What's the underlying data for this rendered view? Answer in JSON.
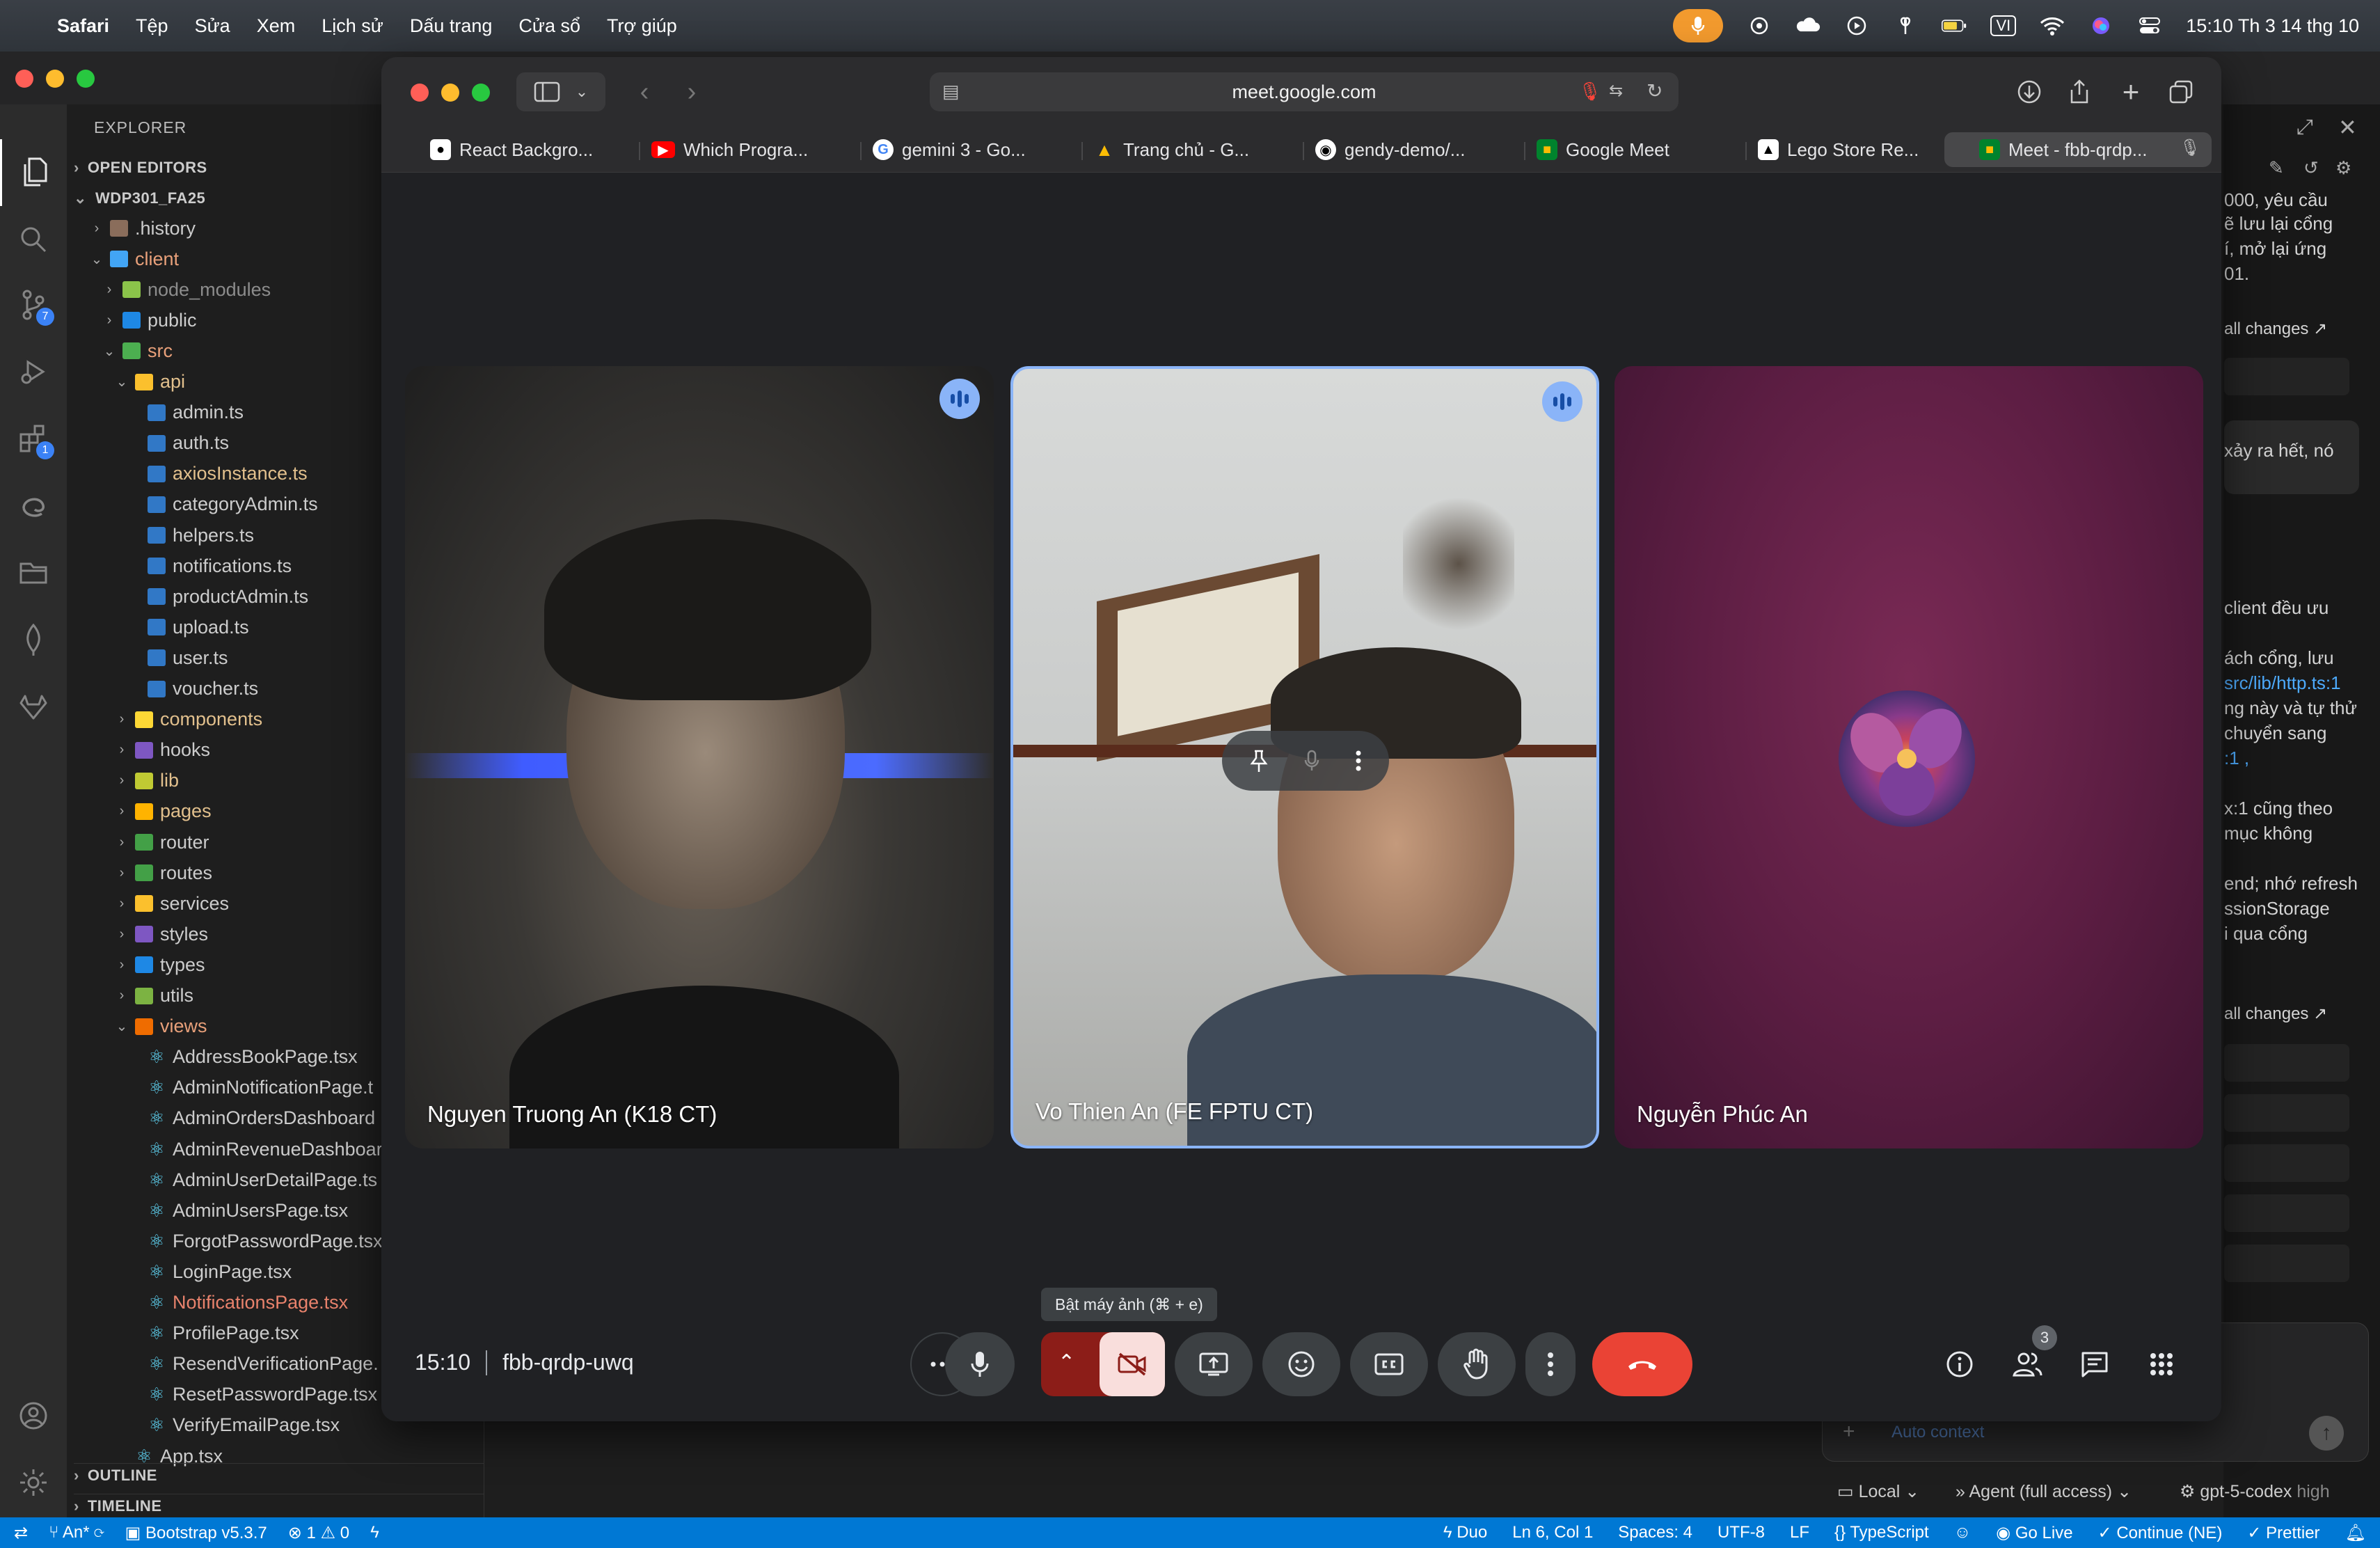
{
  "menubar": {
    "app": "Safari",
    "items": [
      "Tệp",
      "Sửa",
      "Xem",
      "Lịch sử",
      "Dấu trang",
      "Cửa sổ",
      "Trợ giúp"
    ],
    "input_lang": "VI",
    "clock": "15:10 Th 3 14 thg 10"
  },
  "vscode": {
    "explorer_title": "EXPLORER",
    "open_editors": "OPEN EDITORS",
    "workspace": "WDP301_FA25",
    "tree": [
      {
        "label": ".history",
        "depth": 1,
        "kind": "folder",
        "open": false,
        "color": "#cccccc",
        "icon": "history-folder"
      },
      {
        "label": "client",
        "depth": 1,
        "kind": "folder",
        "open": true,
        "color": "#e8a07a",
        "icon": "client-folder"
      },
      {
        "label": "node_modules",
        "depth": 2,
        "kind": "folder",
        "open": false,
        "color": "#8c8c8c",
        "icon": "node-folder"
      },
      {
        "label": "public",
        "depth": 2,
        "kind": "folder",
        "open": false,
        "color": "#cccccc",
        "icon": "public-folder"
      },
      {
        "label": "src",
        "depth": 2,
        "kind": "folder",
        "open": true,
        "color": "#e8a07a",
        "icon": "src-folder"
      },
      {
        "label": "api",
        "depth": 3,
        "kind": "folder",
        "open": true,
        "color": "#e2c08d",
        "icon": "api-folder"
      },
      {
        "label": "admin.ts",
        "depth": 4,
        "kind": "ts",
        "color": "#cccccc"
      },
      {
        "label": "auth.ts",
        "depth": 4,
        "kind": "ts",
        "color": "#cccccc"
      },
      {
        "label": "axiosInstance.ts",
        "depth": 4,
        "kind": "ts",
        "color": "#e2c08d"
      },
      {
        "label": "categoryAdmin.ts",
        "depth": 4,
        "kind": "ts",
        "color": "#cccccc"
      },
      {
        "label": "helpers.ts",
        "depth": 4,
        "kind": "ts",
        "color": "#cccccc"
      },
      {
        "label": "notifications.ts",
        "depth": 4,
        "kind": "ts",
        "color": "#cccccc"
      },
      {
        "label": "productAdmin.ts",
        "depth": 4,
        "kind": "ts",
        "color": "#cccccc"
      },
      {
        "label": "upload.ts",
        "depth": 4,
        "kind": "ts",
        "color": "#cccccc"
      },
      {
        "label": "user.ts",
        "depth": 4,
        "kind": "ts",
        "color": "#cccccc"
      },
      {
        "label": "voucher.ts",
        "depth": 4,
        "kind": "ts",
        "color": "#cccccc"
      },
      {
        "label": "components",
        "depth": 3,
        "kind": "folder",
        "open": false,
        "color": "#e2c08d",
        "icon": "components-folder"
      },
      {
        "label": "hooks",
        "depth": 3,
        "kind": "folder",
        "open": false,
        "color": "#cccccc",
        "icon": "hooks-folder"
      },
      {
        "label": "lib",
        "depth": 3,
        "kind": "folder",
        "open": false,
        "color": "#e2c08d",
        "icon": "lib-folder"
      },
      {
        "label": "pages",
        "depth": 3,
        "kind": "folder",
        "open": false,
        "color": "#e2c08d",
        "icon": "pages-folder"
      },
      {
        "label": "router",
        "depth": 3,
        "kind": "folder",
        "open": false,
        "color": "#cccccc",
        "icon": "router-folder"
      },
      {
        "label": "routes",
        "depth": 3,
        "kind": "folder",
        "open": false,
        "color": "#cccccc",
        "icon": "routes-folder"
      },
      {
        "label": "services",
        "depth": 3,
        "kind": "folder",
        "open": false,
        "color": "#cccccc",
        "icon": "services-folder"
      },
      {
        "label": "styles",
        "depth": 3,
        "kind": "folder",
        "open": false,
        "color": "#cccccc",
        "icon": "styles-folder"
      },
      {
        "label": "types",
        "depth": 3,
        "kind": "folder",
        "open": false,
        "color": "#cccccc",
        "icon": "types-folder"
      },
      {
        "label": "utils",
        "depth": 3,
        "kind": "folder",
        "open": false,
        "color": "#cccccc",
        "icon": "utils-folder"
      },
      {
        "label": "views",
        "depth": 3,
        "kind": "folder",
        "open": true,
        "color": "#e8a07a",
        "icon": "views-folder"
      },
      {
        "label": "AddressBookPage.tsx",
        "depth": 4,
        "kind": "tsx",
        "color": "#cccccc"
      },
      {
        "label": "AdminNotificationPage.t",
        "depth": 4,
        "kind": "tsx",
        "color": "#cccccc"
      },
      {
        "label": "AdminOrdersDashboard",
        "depth": 4,
        "kind": "tsx",
        "color": "#cccccc"
      },
      {
        "label": "AdminRevenueDashboar",
        "depth": 4,
        "kind": "tsx",
        "color": "#cccccc"
      },
      {
        "label": "AdminUserDetailPage.ts",
        "depth": 4,
        "kind": "tsx",
        "color": "#cccccc"
      },
      {
        "label": "AdminUsersPage.tsx",
        "depth": 4,
        "kind": "tsx",
        "color": "#cccccc"
      },
      {
        "label": "ForgotPasswordPage.tsx",
        "depth": 4,
        "kind": "tsx",
        "color": "#cccccc"
      },
      {
        "label": "LoginPage.tsx",
        "depth": 4,
        "kind": "tsx",
        "color": "#cccccc"
      },
      {
        "label": "NotificationsPage.tsx",
        "depth": 4,
        "kind": "tsx",
        "color": "#e8826c"
      },
      {
        "label": "ProfilePage.tsx",
        "depth": 4,
        "kind": "tsx",
        "color": "#cccccc"
      },
      {
        "label": "ResendVerificationPage.",
        "depth": 4,
        "kind": "tsx",
        "color": "#cccccc"
      },
      {
        "label": "ResetPasswordPage.tsx",
        "depth": 4,
        "kind": "tsx",
        "color": "#cccccc"
      },
      {
        "label": "VerifyEmailPage.tsx",
        "depth": 4,
        "kind": "tsx",
        "color": "#cccccc"
      },
      {
        "label": "App.tsx",
        "depth": 3,
        "kind": "tsx",
        "color": "#cccccc"
      }
    ],
    "outline": "OUTLINE",
    "timeline": "TIMELINE",
    "activity_badges": {
      "scm": "7",
      "extensions": "1"
    }
  },
  "rightpanel": {
    "lines": [
      "000, yêu cầu",
      "ẽ lưu lại cổng",
      "í, mở lại ứng",
      "01.",
      "all changes ↗",
      "xảy ra hết, nó",
      "client đều ưu",
      "ách cổng, lưu",
      "src/lib/http.ts:1",
      "ng này và tự thử",
      "chuyển sang",
      ":1 ,",
      "x:1  cũng theo",
      "mục không",
      "end; nhớ refresh",
      "ssionStorage",
      "i qua cổng",
      "all changes ↗"
    ],
    "auto_context": "Auto context",
    "local": "Local",
    "agent": "Agent (full access)",
    "model": "gpt-5-codex",
    "model_level": "high"
  },
  "statusbar": {
    "branch": "An*",
    "bootstrap": "Bootstrap v5.3.7",
    "errors": "1",
    "warnings": "0",
    "duo": "Duo",
    "position": "Ln 6, Col 1",
    "spaces": "Spaces: 4",
    "encoding": "UTF-8",
    "eol": "LF",
    "language": "TypeScript",
    "golive": "Go Live",
    "continue": "Continue (NE)",
    "prettier": "Prettier"
  },
  "safari": {
    "url": "meet.google.com",
    "tabs": [
      {
        "label": "React Backgro...",
        "icon": "react-icon",
        "bg": "#ffffff",
        "fg": "#000000",
        "glyph": "●"
      },
      {
        "label": "Which Progra...",
        "icon": "youtube-icon",
        "bg": "#ff0000",
        "fg": "#ffffff",
        "glyph": "▶"
      },
      {
        "label": "gemini 3 - Go...",
        "icon": "google-icon",
        "bg": "#ffffff",
        "fg": "#4285f4",
        "glyph": "G"
      },
      {
        "label": "Trang chủ - G...",
        "icon": "drive-icon",
        "bg": "transparent",
        "fg": "#fbbc04",
        "glyph": "▲"
      },
      {
        "label": "gendy-demo/...",
        "icon": "github-icon",
        "bg": "#ffffff",
        "fg": "#000000",
        "glyph": "◉"
      },
      {
        "label": "Google Meet",
        "icon": "meet-icon",
        "bg": "#00832d",
        "fg": "#ffffff",
        "glyph": "■"
      },
      {
        "label": "Lego Store Re...",
        "icon": "vercel-icon",
        "bg": "#ffffff",
        "fg": "#000000",
        "glyph": "▲"
      },
      {
        "label": "Meet - fbb-qrdp...",
        "icon": "meet-icon",
        "bg": "#00832d",
        "fg": "#ffffff",
        "glyph": "■"
      }
    ]
  },
  "meet": {
    "participants": [
      {
        "name": "Nguyen Truong An (K18 CT)",
        "speaking": true
      },
      {
        "name": "Vo Thien An (FE FPTU CT)",
        "speaking": true
      },
      {
        "name": "Nguyễn Phúc An",
        "speaking": false
      }
    ],
    "time": "15:10",
    "code": "fbb-qrdp-uwq",
    "tooltip": "Bật máy ảnh (⌘ + e)",
    "people_count": "3",
    "colors": {
      "end_call": "#ea4335",
      "cam_off": "#f9dedc",
      "cam_group": "#8c1d18",
      "speaking": "#8ab4f8"
    }
  }
}
